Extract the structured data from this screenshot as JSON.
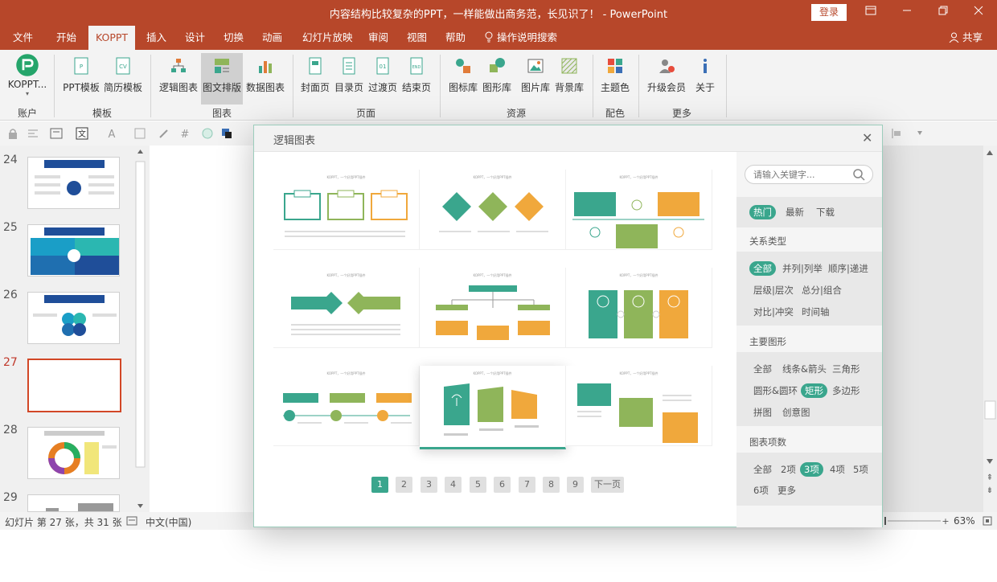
{
  "window": {
    "title": "内容结构比较复杂的PPT，一样能做出商务范，长见识了！ - PowerPoint",
    "login_label": "登录"
  },
  "menu": {
    "tabs": [
      "文件",
      "开始",
      "KOPPT",
      "插入",
      "设计",
      "切换",
      "动画",
      "幻灯片放映",
      "审阅",
      "视图",
      "帮助"
    ],
    "search_label": "操作说明搜索",
    "share_label": "共享"
  },
  "ribbon": {
    "account_button": "KOPPT...",
    "groups": [
      "账户",
      "模板",
      "图表",
      "页面",
      "资源",
      "配色",
      "更多"
    ],
    "buttons": [
      "PPT模板",
      "简历模板",
      "逻辑图表",
      "图文排版",
      "数据图表",
      "封面页",
      "目录页",
      "过渡页",
      "结束页",
      "图标库",
      "图形库",
      "图片库",
      "背景库",
      "主题色",
      "升级会员",
      "关于"
    ]
  },
  "slides": {
    "numbers": [
      "24",
      "25",
      "26",
      "27",
      "28",
      "29"
    ],
    "current": "27"
  },
  "status": {
    "slide_info": "幻灯片 第 27 张，共 31 张",
    "language": "中文(中国)",
    "zoom": "63%"
  },
  "dialog": {
    "title": "逻辑图表",
    "card_title": "KOPPT，一个好用PPT插件",
    "pages": [
      "1",
      "2",
      "3",
      "4",
      "5",
      "6",
      "7",
      "8",
      "9"
    ],
    "next_label": "下一页",
    "search_placeholder": "请输入关键字...",
    "sort_tabs": [
      "热门",
      "最新",
      "下载"
    ],
    "relation_title": "关系类型",
    "relation_tags": [
      "全部",
      "并列|列举",
      "顺序|递进",
      "层级|层次",
      "总分|组合",
      "对比|冲突",
      "时间轴"
    ],
    "shape_title": "主要图形",
    "shape_tags": [
      "全部",
      "线条&箭头",
      "三角形",
      "圆形&圆环",
      "矩形",
      "多边形",
      "拼图",
      "创意图"
    ],
    "count_title": "图表项数",
    "count_tags": [
      "全部",
      "2项",
      "3项",
      "4项",
      "5项",
      "6项",
      "更多"
    ]
  },
  "colors": {
    "brand": "#b7472a",
    "teal": "#3aa68d",
    "green": "#8fb55a",
    "orange": "#f0a83c"
  }
}
